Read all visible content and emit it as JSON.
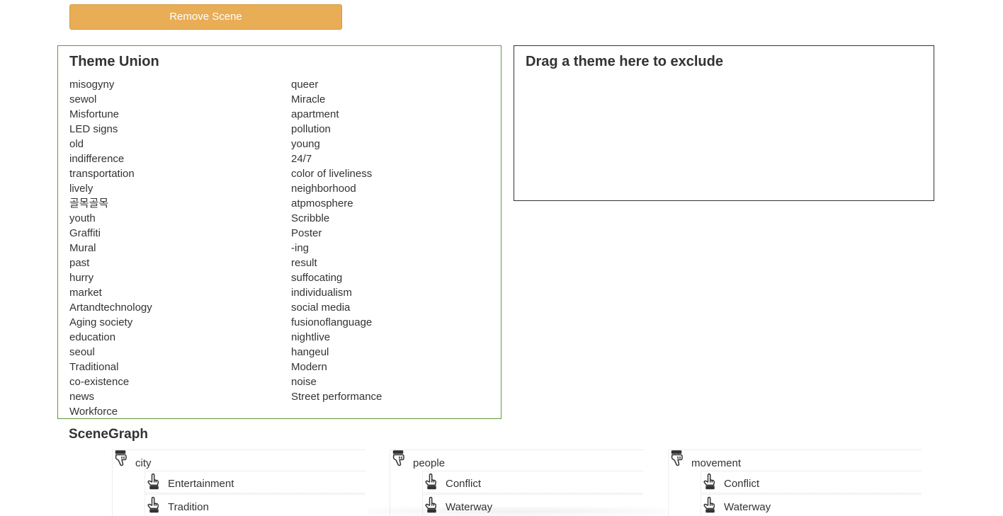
{
  "toolbar": {
    "remove_scene_label": "Remove Scene",
    "button_color": "#e8ad55"
  },
  "theme_union": {
    "title": "Theme Union",
    "border_color": "#5e9a3a",
    "left_column": [
      "misogyny",
      "sewol",
      "Misfortune",
      "LED signs",
      "old",
      "indifference",
      "transportation",
      "lively",
      "골목골목",
      "youth",
      "Graffiti",
      "Mural",
      "past",
      "hurry",
      "market",
      "Artandtechnology",
      "Aging society",
      "education",
      "seoul",
      "Traditional",
      "co-existence",
      "news",
      "Workforce"
    ],
    "right_column": [
      "queer",
      "Miracle",
      "apartment",
      "pollution",
      "young",
      "24/7",
      "color of liveliness",
      "neighborhood",
      "atpmosphere",
      "Scribble",
      "Poster",
      "-ing",
      "result",
      "suffocating",
      "individualism",
      "social media",
      "fusionoflanguage",
      "nightlive",
      "hangeul",
      "Modern",
      "noise",
      "Street performance"
    ]
  },
  "exclude_zone": {
    "title": "Drag a theme here to exclude"
  },
  "scenegraph": {
    "title": "SceneGraph",
    "trees": [
      {
        "root": "city",
        "root_icon": "pointing-down-hand-icon",
        "children": [
          "Entertainment",
          "Tradition"
        ],
        "child_icon": "pointing-up-hand-icon"
      },
      {
        "root": "people",
        "root_icon": "pointing-down-hand-icon",
        "children": [
          "Conflict",
          "Waterway"
        ],
        "child_icon": "pointing-up-hand-icon"
      },
      {
        "root": "movement",
        "root_icon": "pointing-down-hand-icon",
        "children": [
          "Conflict",
          "Waterway"
        ],
        "child_icon": "pointing-up-hand-icon"
      }
    ]
  }
}
